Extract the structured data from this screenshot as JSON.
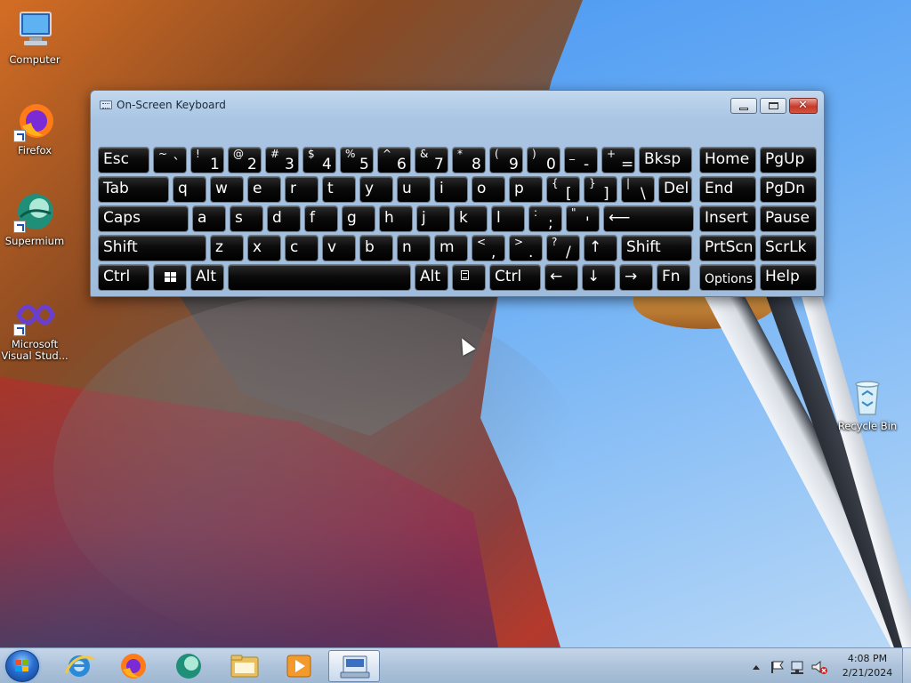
{
  "desktop": {
    "icons": [
      {
        "label": "Computer",
        "icon": "computer-icon"
      },
      {
        "label": "Firefox",
        "icon": "firefox-icon"
      },
      {
        "label": "Supermium",
        "icon": "supermium-icon"
      },
      {
        "label": "Microsoft Visual Stud...",
        "line1": "Microsoft",
        "line2": "Visual Stud...",
        "icon": "visual-studio-icon"
      },
      {
        "label": "Recycle Bin",
        "icon": "recycle-bin-icon"
      }
    ]
  },
  "osk": {
    "title": "On-Screen Keyboard",
    "window_controls": [
      "minimize",
      "maximize",
      "close"
    ],
    "close_glyph": "✕",
    "rows": [
      [
        {
          "label": "Esc"
        },
        {
          "up": "~",
          "down": "`"
        },
        {
          "up": "!",
          "down": "1"
        },
        {
          "up": "@",
          "down": "2"
        },
        {
          "up": "#",
          "down": "3"
        },
        {
          "up": "$",
          "down": "4"
        },
        {
          "up": "%",
          "down": "5"
        },
        {
          "up": "^",
          "down": "6"
        },
        {
          "up": "&",
          "down": "7"
        },
        {
          "up": "*",
          "down": "8"
        },
        {
          "up": "(",
          "down": "9"
        },
        {
          "up": ")",
          "down": "0"
        },
        {
          "up": "_",
          "down": "-"
        },
        {
          "up": "+",
          "down": "="
        },
        {
          "label": "Bksp"
        },
        {
          "label": "Home"
        },
        {
          "label": "PgUp"
        }
      ],
      [
        {
          "label": "Tab"
        },
        {
          "label": "q"
        },
        {
          "label": "w"
        },
        {
          "label": "e"
        },
        {
          "label": "r"
        },
        {
          "label": "t"
        },
        {
          "label": "y"
        },
        {
          "label": "u"
        },
        {
          "label": "i"
        },
        {
          "label": "o"
        },
        {
          "label": "p"
        },
        {
          "up": "{",
          "down": "["
        },
        {
          "up": "}",
          "down": "]"
        },
        {
          "up": "|",
          "down": "\\"
        },
        {
          "label": "Del"
        },
        {
          "label": "End"
        },
        {
          "label": "PgDn"
        }
      ],
      [
        {
          "label": "Caps"
        },
        {
          "label": "a"
        },
        {
          "label": "s"
        },
        {
          "label": "d"
        },
        {
          "label": "f"
        },
        {
          "label": "g"
        },
        {
          "label": "h"
        },
        {
          "label": "j"
        },
        {
          "label": "k"
        },
        {
          "label": "l"
        },
        {
          "up": ":",
          "down": ";"
        },
        {
          "up": "\"",
          "down": "'"
        },
        {
          "label": "⟵"
        },
        {
          "label": "Insert"
        },
        {
          "label": "Pause"
        }
      ],
      [
        {
          "label": "Shift"
        },
        {
          "label": "z"
        },
        {
          "label": "x"
        },
        {
          "label": "c"
        },
        {
          "label": "v"
        },
        {
          "label": "b"
        },
        {
          "label": "n"
        },
        {
          "label": "m"
        },
        {
          "up": "<",
          "down": ","
        },
        {
          "up": ">",
          "down": "."
        },
        {
          "up": "?",
          "down": "/"
        },
        {
          "label": "↑"
        },
        {
          "label": "Shift"
        },
        {
          "label": "PrtScn"
        },
        {
          "label": "ScrLk"
        }
      ],
      [
        {
          "label": "Ctrl"
        },
        {
          "label": "",
          "icon": "windows-logo-icon"
        },
        {
          "label": "Alt"
        },
        {
          "label": ""
        },
        {
          "label": "Alt"
        },
        {
          "label": "",
          "icon": "menu-icon"
        },
        {
          "label": "Ctrl"
        },
        {
          "label": "←"
        },
        {
          "label": "↓"
        },
        {
          "label": "→"
        },
        {
          "label": "Fn"
        },
        {
          "label": "Options"
        },
        {
          "label": "Help"
        }
      ]
    ]
  },
  "taskbar": {
    "pinned": [
      {
        "name": "internet-explorer",
        "icon": "internet-explorer-icon"
      },
      {
        "name": "firefox",
        "icon": "firefox-icon"
      },
      {
        "name": "supermium",
        "icon": "supermium-icon"
      },
      {
        "name": "file-explorer",
        "icon": "folder-icon"
      },
      {
        "name": "media-player",
        "icon": "media-player-icon"
      },
      {
        "name": "on-screen-keyboard",
        "icon": "keyboard-icon",
        "active": true
      }
    ],
    "tray": {
      "icons": [
        "show-hidden-icons-icon",
        "action-center-flag-icon",
        "network-icon",
        "volume-muted-icon"
      ],
      "time": "4:08 PM",
      "date": "2/21/2024"
    }
  }
}
